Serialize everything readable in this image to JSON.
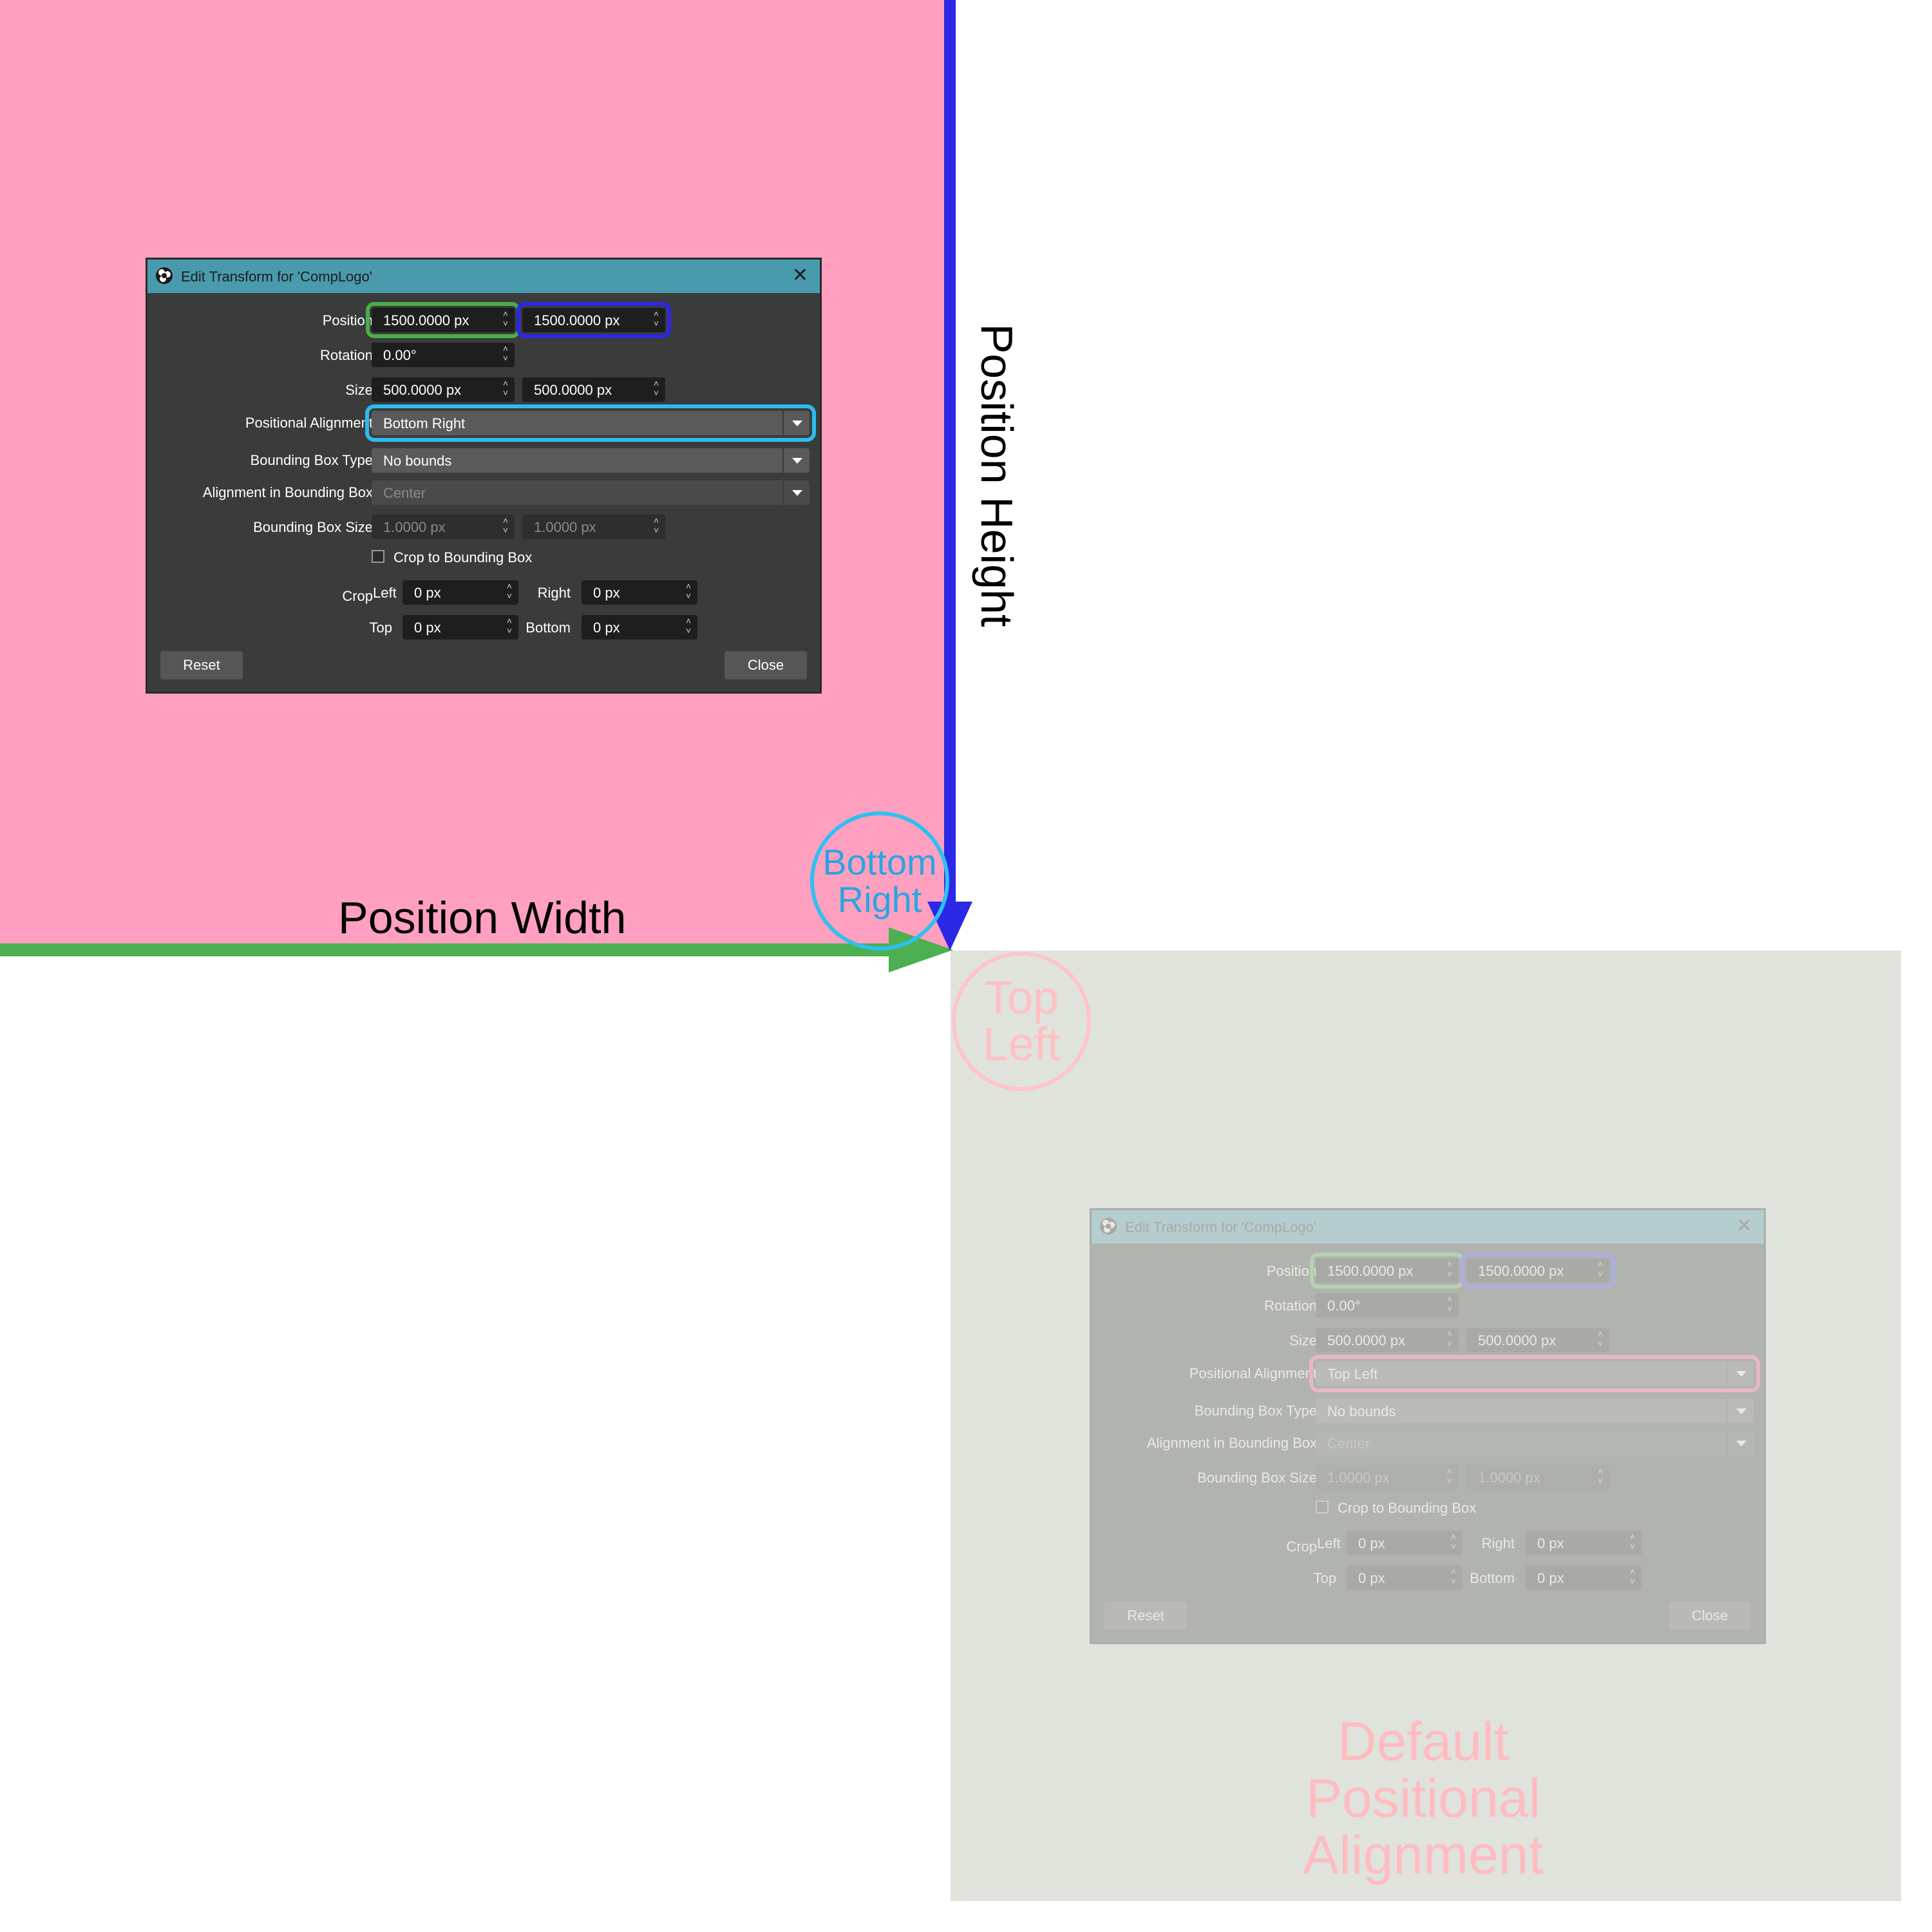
{
  "dialogs": {
    "main": {
      "title": "Edit Transform for 'CompLogo'",
      "position_label": "Position",
      "position_x": "1500.0000 px",
      "position_y": "1500.0000 px",
      "rotation_label": "Rotation",
      "rotation": "0.00°",
      "size_label": "Size",
      "size_w": "500.0000 px",
      "size_h": "500.0000 px",
      "positional_alignment_label": "Positional Alignment",
      "positional_alignment": "Bottom Right",
      "bbox_type_label": "Bounding Box Type",
      "bbox_type": "No bounds",
      "bbox_alignment_label": "Alignment in Bounding Box",
      "bbox_alignment": "Center",
      "bbox_size_label": "Bounding Box Size",
      "bbox_w": "1.0000 px",
      "bbox_h": "1.0000 px",
      "crop_to_bbox": "Crop to Bounding Box",
      "crop_label": "Crop",
      "left_label": "Left",
      "left": "0 px",
      "right_label": "Right",
      "right": "0 px",
      "top_label": "Top",
      "top": "0 px",
      "bottom_label": "Bottom",
      "bottom": "0 px",
      "reset": "Reset",
      "close": "Close"
    },
    "faded": {
      "title": "Edit Transform for 'CompLogo'",
      "position_label": "Position",
      "position_x": "1500.0000 px",
      "position_y": "1500.0000 px",
      "rotation_label": "Rotation",
      "rotation": "0.00°",
      "size_label": "Size",
      "size_w": "500.0000 px",
      "size_h": "500.0000 px",
      "positional_alignment_label": "Positional Alignment",
      "positional_alignment": "Top Left",
      "bbox_type_label": "Bounding Box Type",
      "bbox_type": "No bounds",
      "bbox_alignment_label": "Alignment in Bounding Box",
      "bbox_alignment": "Center",
      "bbox_size_label": "Bounding Box Size",
      "bbox_w": "1.0000 px",
      "bbox_h": "1.0000 px",
      "crop_to_bbox": "Crop to Bounding Box",
      "crop_label": "Crop",
      "left_label": "Left",
      "left": "0 px",
      "right_label": "Right",
      "right": "0 px",
      "top_label": "Top",
      "top": "0 px",
      "bottom_label": "Bottom",
      "bottom": "0 px",
      "reset": "Reset",
      "close": "Close"
    }
  },
  "annotations": {
    "position_width": "Position Width",
    "position_height": "Position Height",
    "bottom_right_line1": "Bottom",
    "bottom_right_line2": "Right",
    "top_left_line1": "Top",
    "top_left_line2": "Left",
    "default_line1": "Default",
    "default_line2": "Positional",
    "default_line3": "Alignment"
  },
  "colors": {
    "pink_region": "#ffa0c0",
    "gray_region": "#e0e2dc",
    "width_arrow": "#4caf50",
    "height_arrow": "#2b28e6",
    "bottom_right_circle": "#2fc0f0",
    "titlebar": "#4a9aad"
  },
  "icons": [
    "obs-icon",
    "close-icon",
    "spin-arrows-icon",
    "dropdown-arrow-icon",
    "checkbox"
  ]
}
